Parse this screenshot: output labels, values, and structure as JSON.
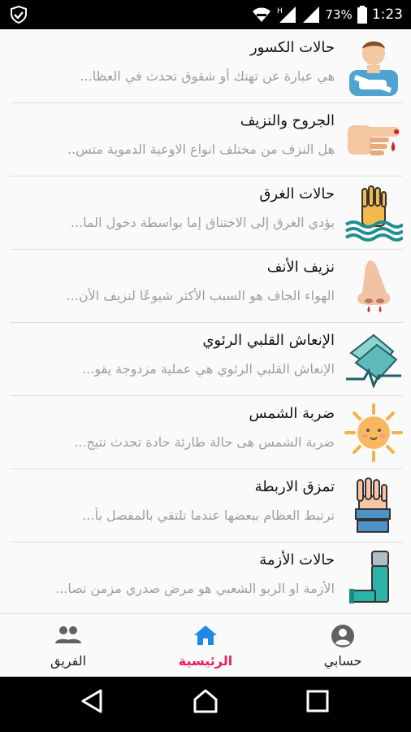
{
  "status_bar": {
    "battery_percent": "73%",
    "time": "1:23",
    "icons": [
      "shield-check-icon",
      "wifi-icon",
      "signal-h-icon",
      "signal-icon",
      "battery-icon"
    ]
  },
  "cases": [
    {
      "title": "حالات الكسور",
      "description": "هي عبارة عن تهتك أو شقوق تحدث في العظا...",
      "icon": "broken-arm-icon"
    },
    {
      "title": "الجروح والنزيف",
      "description": "هل النزف من مختلف انواع الاوعية الدموية متس..",
      "icon": "bleeding-finger-icon"
    },
    {
      "title": "حالات الغرق",
      "description": "يؤدي الغرق إلى الاختناق إما بواسطة دخول الما...",
      "icon": "drowning-hand-icon"
    },
    {
      "title": "نزيف الأنف",
      "description": "الهواء الجاف هو السبب الأكثر شيوعًا لنزيف الأن...",
      "icon": "nose-bleed-icon"
    },
    {
      "title": "الإنعاش القلبي الرئوي",
      "description": "الإنعاش القلبي الرئوي هي عملية مزدوجة يقو...",
      "icon": "cpr-hands-icon"
    },
    {
      "title": "ضربة الشمس",
      "description": "ضربة الشمس هى حالة طارئة حادة تحدث نتيج...",
      "icon": "sun-icon"
    },
    {
      "title": "تمزق الاربطة",
      "description": "ترتبط العظام ببعضها عندما تلتقي بالمفصل بأ...",
      "icon": "bandaged-hand-icon"
    },
    {
      "title": "حالات الأزمة",
      "description": "الأزمة او الربو الشعبي هو مرض صدري مزمن تصا...",
      "icon": "inhaler-icon"
    }
  ],
  "bottom_nav": {
    "team_label": "الفريق",
    "home_label": "الرئيسية",
    "account_label": "حسابي",
    "active": "home",
    "active_color": "#e91e63",
    "home_icon_color": "#1e88e5"
  }
}
